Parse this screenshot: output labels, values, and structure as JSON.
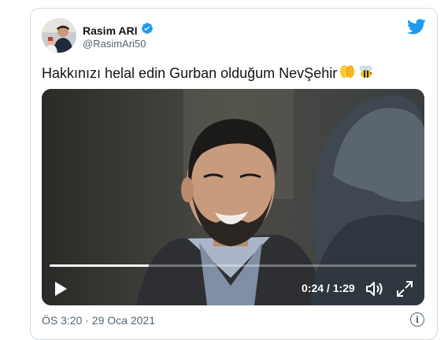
{
  "tweet": {
    "author": {
      "display_name": "Rasim ARI",
      "handle": "@RasimAri50",
      "verified": true
    },
    "text": "Hakkınızı helal edin Gurban olduğum NevŞehir",
    "emojis": [
      "folded-hands",
      "bee"
    ],
    "timestamp": "ÖS 3:20 · 29 Oca 2021"
  },
  "video": {
    "time_display": "0:24 / 1:29",
    "progress": 0.27
  },
  "colors": {
    "twitter_blue": "#1d9bf0",
    "text_primary": "#0f1419",
    "text_secondary": "#536471",
    "border": "#cfd9de"
  },
  "icons": [
    "twitter-bird-icon",
    "verified-badge-icon",
    "play-icon",
    "volume-icon",
    "fullscreen-icon",
    "info-icon"
  ]
}
